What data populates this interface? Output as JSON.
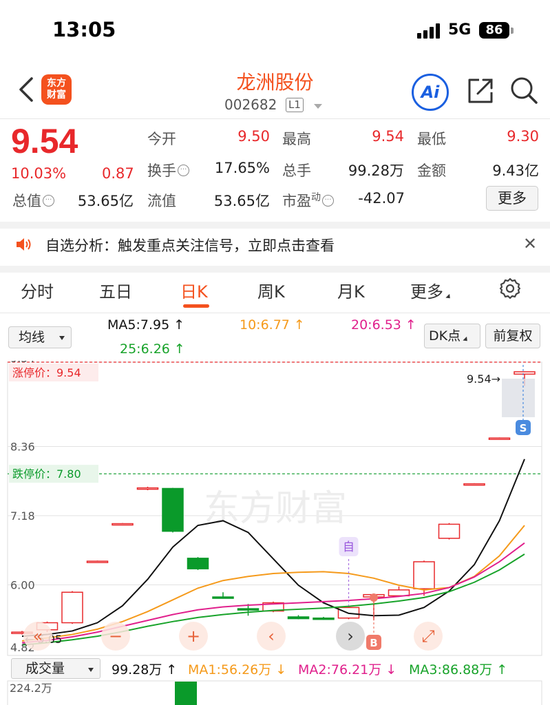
{
  "status_bar": {
    "time": "13:05",
    "network": "5G",
    "battery": "86"
  },
  "nav": {
    "logo_line1": "东方",
    "logo_line2": "财富",
    "title": "龙洲股份",
    "code": "002682",
    "level": "L1",
    "ai_label": "Ai"
  },
  "quote": {
    "price": "9.54",
    "change_pct": "10.03%",
    "change": "0.87",
    "open_label": "今开",
    "open": "9.50",
    "high_label": "最高",
    "high": "9.54",
    "low_label": "最低",
    "low": "9.30",
    "turnover_label": "换手",
    "turnover": "17.65%",
    "volume_label": "总手",
    "volume": "99.28万",
    "amount_label": "金额",
    "amount": "9.43亿",
    "mcap_label": "总值",
    "mcap": "53.65亿",
    "float_label": "流值",
    "float": "53.65亿",
    "pe_label": "市盈",
    "pe_sup": "动",
    "pe": "-42.07",
    "more_label": "更多"
  },
  "notice": {
    "text": "自选分析：触发重点关注信号，立即点击查看"
  },
  "tabs": {
    "items": [
      "分时",
      "五日",
      "日K",
      "周K",
      "月K",
      "更多"
    ],
    "active_index": 2
  },
  "indicators": {
    "select_label": "均线",
    "ma5": "MA5:7.95 ↑",
    "ma10": "10:6.77 ↑",
    "ma20": "20:6.53 ↑",
    "ma25": "25:6.26 ↑",
    "dk_label": "DK点",
    "fq_label": "前复权"
  },
  "colors": {
    "up": "#e8282b",
    "down": "#0a9a2a",
    "accent": "#f4511e",
    "ma5": "#111111",
    "ma10": "#f59a1b",
    "ma20": "#e0208c",
    "ma25": "#18a32a"
  },
  "chart_data": {
    "type": "candlestick",
    "price_labels": [
      "9.54",
      "8.36",
      "7.18",
      "6.00",
      "4.82"
    ],
    "limit_up_label": "涨停价：9.54",
    "limit_down_label": "跌停价：7.80",
    "last_price_label": "9.54",
    "low_marker_label": "5.05",
    "watermark": "东方财富",
    "markers": {
      "self": "自",
      "buy": "B",
      "sell": "S"
    },
    "ylim": [
      4.82,
      9.54
    ],
    "candles": [
      {
        "o": 5.08,
        "c": 5.1,
        "h": 5.12,
        "l": 5.06
      },
      {
        "o": 5.14,
        "c": 5.26,
        "h": 5.28,
        "l": 5.1
      },
      {
        "o": 5.26,
        "c": 5.78,
        "h": 5.8,
        "l": 5.24
      },
      {
        "o": 6.3,
        "c": 6.31,
        "h": 6.32,
        "l": 6.29
      },
      {
        "o": 6.94,
        "c": 6.95,
        "h": 6.96,
        "l": 6.93
      },
      {
        "o": 7.55,
        "c": 7.56,
        "h": 7.58,
        "l": 7.52
      },
      {
        "o": 7.55,
        "c": 6.82,
        "h": 7.56,
        "l": 6.8
      },
      {
        "o": 6.36,
        "c": 6.18,
        "h": 6.38,
        "l": 6.16
      },
      {
        "o": 5.7,
        "c": 5.69,
        "h": 5.78,
        "l": 5.68
      },
      {
        "o": 5.5,
        "c": 5.48,
        "h": 5.58,
        "l": 5.38
      },
      {
        "o": 5.46,
        "c": 5.6,
        "h": 5.62,
        "l": 5.44
      },
      {
        "o": 5.36,
        "c": 5.33,
        "h": 5.39,
        "l": 5.32
      },
      {
        "o": 5.34,
        "c": 5.33,
        "h": 5.36,
        "l": 5.31
      },
      {
        "o": 5.34,
        "c": 5.52,
        "h": 5.54,
        "l": 5.32
      },
      {
        "o": 5.7,
        "c": 5.74,
        "h": 5.76,
        "l": 5.3
      },
      {
        "o": 5.72,
        "c": 5.82,
        "h": 5.88,
        "l": 5.7
      },
      {
        "o": 5.84,
        "c": 6.3,
        "h": 6.32,
        "l": 5.72
      },
      {
        "o": 6.7,
        "c": 6.94,
        "h": 6.96,
        "l": 6.68
      },
      {
        "o": 7.62,
        "c": 7.63,
        "h": 7.64,
        "l": 7.61
      },
      {
        "o": 8.4,
        "c": 8.41,
        "h": 8.42,
        "l": 8.39
      },
      {
        "o": 9.5,
        "c": 9.54,
        "h": 9.54,
        "l": 9.3
      }
    ],
    "ma_series": [
      {
        "name": "MA5",
        "values": [
          5.03,
          5.06,
          5.12,
          5.26,
          5.55,
          6.0,
          6.55,
          6.92,
          7.0,
          6.8,
          6.35,
          5.9,
          5.6,
          5.42,
          5.38,
          5.39,
          5.52,
          5.8,
          6.25,
          7.0,
          8.05
        ]
      },
      {
        "name": "MA10",
        "values": [
          4.95,
          5.0,
          5.06,
          5.15,
          5.28,
          5.45,
          5.65,
          5.85,
          5.98,
          6.05,
          6.1,
          6.12,
          6.13,
          6.1,
          6.02,
          5.9,
          5.82,
          5.86,
          6.05,
          6.4,
          6.92
        ]
      },
      {
        "name": "MA20",
        "values": [
          4.92,
          4.96,
          5.02,
          5.1,
          5.2,
          5.3,
          5.4,
          5.48,
          5.53,
          5.56,
          5.58,
          5.6,
          5.62,
          5.64,
          5.67,
          5.71,
          5.76,
          5.86,
          6.04,
          6.3,
          6.62
        ]
      },
      {
        "name": "MA25",
        "values": [
          4.88,
          4.92,
          4.97,
          5.03,
          5.11,
          5.2,
          5.28,
          5.35,
          5.4,
          5.44,
          5.47,
          5.49,
          5.51,
          5.54,
          5.58,
          5.63,
          5.69,
          5.79,
          5.95,
          6.16,
          6.43
        ]
      }
    ],
    "nav_buttons": [
      "«",
      "−",
      "+",
      "‹",
      "›",
      "⤢"
    ]
  },
  "volume": {
    "select_label": "成交量",
    "vol": "99.28万 ↑",
    "ma1": "MA1:56.26万 ↓",
    "ma2": "MA2:76.21万 ↓",
    "ma3": "MA3:86.88万 ↑",
    "max_label": "224.2万"
  }
}
